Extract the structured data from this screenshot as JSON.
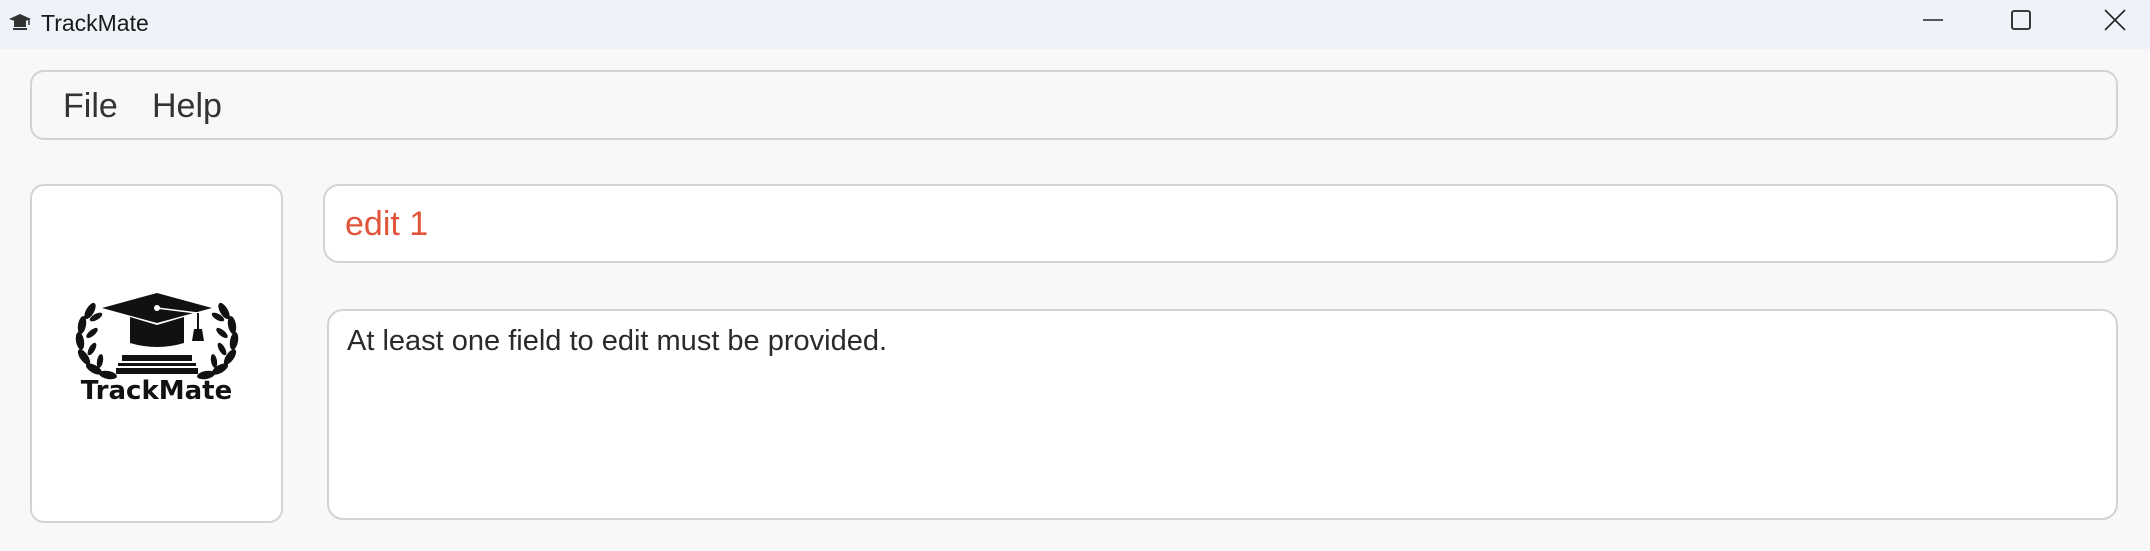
{
  "window": {
    "title": "TrackMate",
    "icon": "graduation-cap-icon",
    "controls": [
      "minimize-icon",
      "maximize-icon",
      "close-icon"
    ]
  },
  "menubar": {
    "items": [
      {
        "label": "File"
      },
      {
        "label": "Help"
      }
    ]
  },
  "logo": {
    "text": "TrackMate",
    "icon": "graduation-cap-laurel-icon"
  },
  "command": {
    "value": "edit 1",
    "color": "#e0553a"
  },
  "result": {
    "message": "At least one field to edit must be provided."
  }
}
